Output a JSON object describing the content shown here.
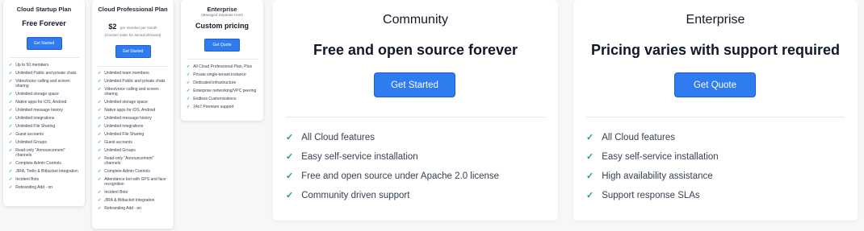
{
  "startup": {
    "title": "Cloud Startup Plan",
    "price": "Free Forever",
    "button": "Get Started",
    "features": [
      "Up to 50 members",
      "Unlimited Public and private chats",
      "Video/voice calling and screen sharing",
      "Unlimited storage space",
      "Native apps for iOS, Android",
      "Unlimited message history",
      "Unlimited integrations",
      "Unlimited File Sharing",
      "Guest accounts",
      "Unlimited Groups",
      "Read-only \"Announcement\" channels",
      "Complete Admin Controls",
      "JIRA, Trello & Bitbucket Integration",
      "Incident Bots",
      "Rebranding Add - on"
    ]
  },
  "professional": {
    "title": "Cloud Professional Plan",
    "price": "$2",
    "price_unit": "per member per month",
    "note": "(Contact sales for annual discount)",
    "button": "Get Started",
    "features": [
      "Unlimited team members",
      "Unlimited Public and private chats",
      "Video/voice calling and screen sharing",
      "Unlimited storage space",
      "Native apps for iOS, Android",
      "Unlimited message history",
      "Unlimited integrations",
      "Unlimited File Sharing",
      "Guest accounts",
      "Unlimited Groups",
      "Read-only \"Announcement\" channels",
      "Complete Admin Controls",
      "Attendance bot with GPS and face recognition",
      "Incident Bots",
      "JIRA & Bitbucket Integration",
      "Rebranding Add - on"
    ]
  },
  "enterprise_small": {
    "title": "Enterprise",
    "subtitle": "(Managed Separate Host)",
    "price": "Custom pricing",
    "button": "Get Quote",
    "features": [
      "All Cloud Professional Plan, Plus",
      "Private single-tenant instance",
      "Dedicated infrastructure",
      "Enterprise networking/VPC peering",
      "Endless Customizations",
      "24x7 Premium support"
    ]
  },
  "community": {
    "title": "Community",
    "headline": "Free and open source forever",
    "button": "Get Started",
    "features": [
      "All Cloud features",
      "Easy self-service installation",
      "Free and open source under Apache 2.0 license",
      "Community driven support"
    ]
  },
  "enterprise": {
    "title": "Enterprise",
    "headline": "Pricing varies with support required",
    "button": "Get Quote",
    "features": [
      "All Cloud features",
      "Easy self-service installation",
      "High availability assistance",
      "Support response SLAs"
    ]
  },
  "check_glyph": "✓",
  "colors": {
    "accent": "#2f7bf0",
    "check": "#20a36b"
  }
}
